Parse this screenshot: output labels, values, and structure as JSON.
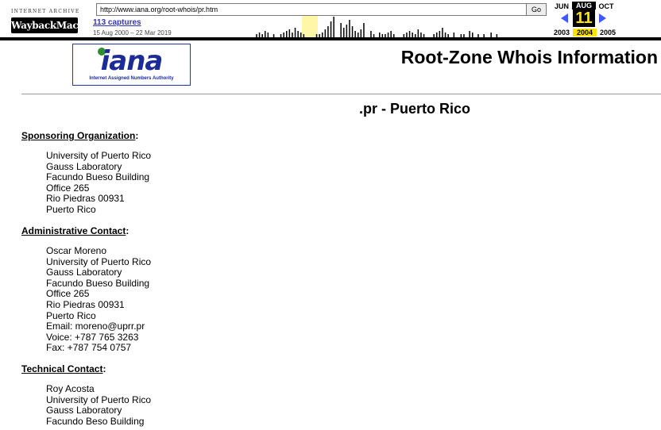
{
  "toolbar": {
    "logo_top": "INTERNET ARCHIVE",
    "logo_main": "WaybackMachine",
    "url_value": "http://www.iana.org/root-whois/pr.htm",
    "go_label": "Go",
    "captures_link": "113 captures",
    "date_range": "15 Aug 2000 – 22 Mar 2019",
    "calendar": {
      "prev_month": "JUN",
      "current_month": "AUG",
      "next_month": "OCT",
      "day": "11",
      "prev_year": "2003",
      "current_year": "2004",
      "next_year": "2005"
    }
  },
  "iana_logo": {
    "word": "iana",
    "subtitle": "Internet Assigned Numbers Authority"
  },
  "page": {
    "heading": "Root-Zone Whois Information",
    "domain_title": ".pr - Puerto Rico"
  },
  "sections": [
    {
      "title": "Sponsoring Organization",
      "lines": [
        "University of Puerto Rico",
        "Gauss Laboratory",
        "Facundo Bueso Building",
        "Office 265",
        "Rio Piedras 00931",
        "Puerto Rico"
      ]
    },
    {
      "title": "Administrative Contact",
      "lines": [
        "Oscar Moreno",
        "University of Puerto Rico",
        "Gauss Laboratory",
        "Facundo Bueso Building",
        "Office 265",
        "Rio Piedras 00931",
        "Puerto Rico",
        "Email: moreno@uprr.pr",
        "Voice: +787 765 3263",
        "Fax: +787 754 0757"
      ]
    },
    {
      "title": "Technical Contact",
      "lines": [
        "Roy Acosta",
        "University of Puerto Rico",
        "Gauss Laboratory",
        "Facundo Beso Building"
      ]
    }
  ],
  "colors": {
    "link_blue": "#3333bb",
    "iana_blue": "#1d2b99",
    "calendar_yellow": "#ffe400",
    "arrow_blue": "#3d59ff"
  }
}
